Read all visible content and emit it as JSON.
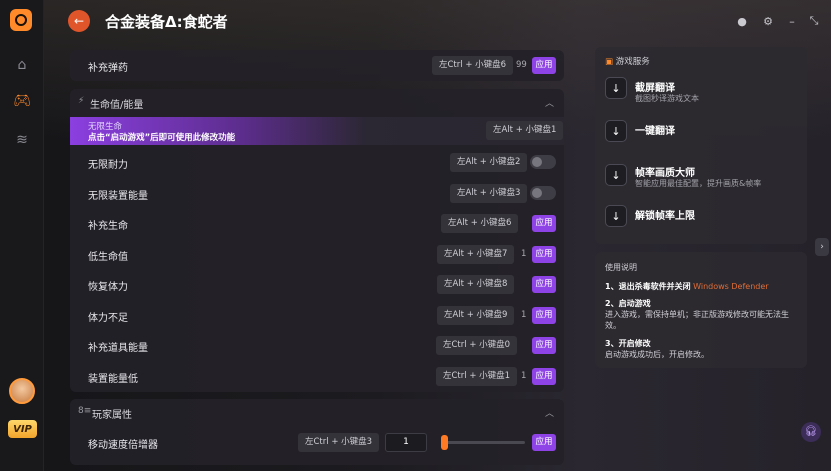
{
  "header": {
    "title": "合金装备Δ:食蛇者"
  },
  "top_row": {
    "label": "补充弹药",
    "hotkey": "左Ctrl + 小键盘6",
    "value": "99",
    "apply": "应用"
  },
  "section_health": {
    "title": "生命值/能量",
    "icon": "⚡"
  },
  "highlight_row": {
    "title": "无限生命",
    "subtitle": "点击“启动游戏”后即可使用此修改功能",
    "hotkey": "左Alt + 小键盘1"
  },
  "rows": [
    {
      "label": "无限耐力",
      "hotkey": "左Alt + 小键盘2",
      "control": "toggle"
    },
    {
      "label": "无限装置能量",
      "hotkey": "左Alt + 小键盘3",
      "control": "toggle"
    },
    {
      "label": "补充生命",
      "hotkey": "左Alt + 小键盘6",
      "control": "apply",
      "apply": "应用"
    },
    {
      "label": "低生命值",
      "hotkey": "左Alt + 小键盘7",
      "value": "1",
      "control": "apply",
      "apply": "应用"
    },
    {
      "label": "恢复体力",
      "hotkey": "左Alt + 小键盘8",
      "control": "apply",
      "apply": "应用"
    },
    {
      "label": "体力不足",
      "hotkey": "左Alt + 小键盘9",
      "value": "1",
      "control": "apply",
      "apply": "应用"
    },
    {
      "label": "补充道具能量",
      "hotkey": "左Ctrl + 小键盘0",
      "control": "apply",
      "apply": "应用"
    },
    {
      "label": "装置能量低",
      "hotkey": "左Ctrl + 小键盘1",
      "value": "1",
      "control": "apply",
      "apply": "应用"
    }
  ],
  "section_player": {
    "title": "玩家属性",
    "icon": "8≡"
  },
  "speed_row": {
    "label": "移动速度倍增器",
    "hotkey": "左Ctrl + 小键盘3",
    "input_value": "1",
    "slider_level": 0.0,
    "apply": "应用"
  },
  "services": {
    "title": "游戏服务",
    "items": [
      {
        "name": "截屏翻译",
        "desc": "截图秒译游戏文本",
        "icon": "download-icon"
      },
      {
        "name": "一键翻译",
        "desc": "",
        "icon": "download-icon"
      },
      {
        "name": "帧率画质大师",
        "desc": "智能应用最佳配置，提升画质&帧率",
        "icon": "download-icon"
      },
      {
        "name": "解锁帧率上限",
        "desc": "",
        "icon": "download-icon"
      }
    ]
  },
  "guide": {
    "title": "使用说明",
    "step1_title": "1、退出杀毒软件并关闭",
    "step1_highlight": "Windows Defender",
    "step2_title": "2、启动游戏",
    "step2_text": "进入游戏，需保持单机；非正版游戏修改可能无法生效。",
    "step3_title": "3、开启修改",
    "step3_text": "启动游戏成功后，开启修改。"
  },
  "rail": {
    "vip": "VIP"
  },
  "colors": {
    "accent": "#8e43e6",
    "brand": "#ff8a2a",
    "warning": "#e06d38"
  }
}
